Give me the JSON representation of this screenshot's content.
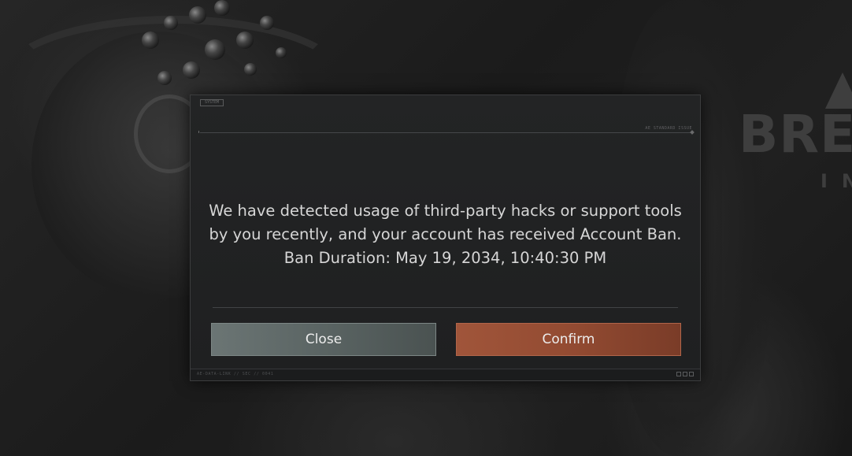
{
  "dialog": {
    "tag_label": "SYSTEM",
    "header_rule_label": "AE STANDARD ISSUE",
    "message": "We have detected usage of third-party hacks or support tools by you recently, and your account has received Account Ban. Ban Duration: May 19, 2034, 10:40:30 PM",
    "close_label": "Close",
    "confirm_label": "Confirm",
    "footer_text": "AE-DATA-LINK  //  SEC  //  0041"
  },
  "background": {
    "logo_word": "BRE",
    "logo_sub": "IN"
  },
  "colors": {
    "close_button": "#5a6463",
    "confirm_button": "#934b32",
    "dialog_bg": "#1f2021",
    "message_text": "#d6d6d6"
  },
  "icons": {
    "footer_indicator": "square-boxes-icon",
    "header_marker": "diamond-icon"
  }
}
